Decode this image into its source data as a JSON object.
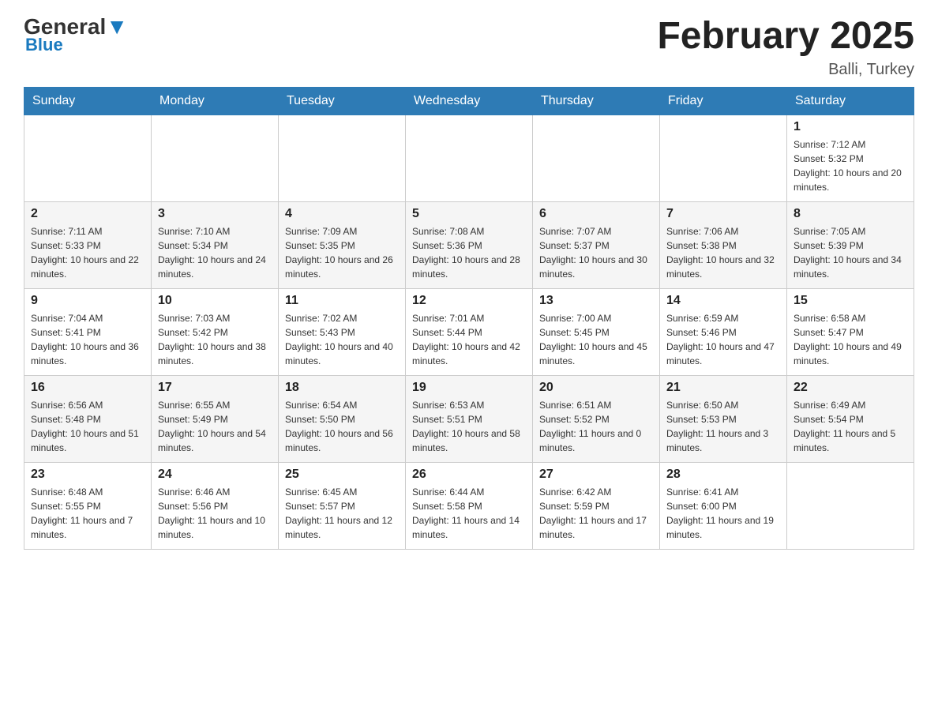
{
  "header": {
    "logo_general": "General",
    "logo_blue": "Blue",
    "month_title": "February 2025",
    "location": "Balli, Turkey"
  },
  "weekdays": [
    "Sunday",
    "Monday",
    "Tuesday",
    "Wednesday",
    "Thursday",
    "Friday",
    "Saturday"
  ],
  "rows": [
    [
      {
        "day": "",
        "info": ""
      },
      {
        "day": "",
        "info": ""
      },
      {
        "day": "",
        "info": ""
      },
      {
        "day": "",
        "info": ""
      },
      {
        "day": "",
        "info": ""
      },
      {
        "day": "",
        "info": ""
      },
      {
        "day": "1",
        "info": "Sunrise: 7:12 AM\nSunset: 5:32 PM\nDaylight: 10 hours and 20 minutes."
      }
    ],
    [
      {
        "day": "2",
        "info": "Sunrise: 7:11 AM\nSunset: 5:33 PM\nDaylight: 10 hours and 22 minutes."
      },
      {
        "day": "3",
        "info": "Sunrise: 7:10 AM\nSunset: 5:34 PM\nDaylight: 10 hours and 24 minutes."
      },
      {
        "day": "4",
        "info": "Sunrise: 7:09 AM\nSunset: 5:35 PM\nDaylight: 10 hours and 26 minutes."
      },
      {
        "day": "5",
        "info": "Sunrise: 7:08 AM\nSunset: 5:36 PM\nDaylight: 10 hours and 28 minutes."
      },
      {
        "day": "6",
        "info": "Sunrise: 7:07 AM\nSunset: 5:37 PM\nDaylight: 10 hours and 30 minutes."
      },
      {
        "day": "7",
        "info": "Sunrise: 7:06 AM\nSunset: 5:38 PM\nDaylight: 10 hours and 32 minutes."
      },
      {
        "day": "8",
        "info": "Sunrise: 7:05 AM\nSunset: 5:39 PM\nDaylight: 10 hours and 34 minutes."
      }
    ],
    [
      {
        "day": "9",
        "info": "Sunrise: 7:04 AM\nSunset: 5:41 PM\nDaylight: 10 hours and 36 minutes."
      },
      {
        "day": "10",
        "info": "Sunrise: 7:03 AM\nSunset: 5:42 PM\nDaylight: 10 hours and 38 minutes."
      },
      {
        "day": "11",
        "info": "Sunrise: 7:02 AM\nSunset: 5:43 PM\nDaylight: 10 hours and 40 minutes."
      },
      {
        "day": "12",
        "info": "Sunrise: 7:01 AM\nSunset: 5:44 PM\nDaylight: 10 hours and 42 minutes."
      },
      {
        "day": "13",
        "info": "Sunrise: 7:00 AM\nSunset: 5:45 PM\nDaylight: 10 hours and 45 minutes."
      },
      {
        "day": "14",
        "info": "Sunrise: 6:59 AM\nSunset: 5:46 PM\nDaylight: 10 hours and 47 minutes."
      },
      {
        "day": "15",
        "info": "Sunrise: 6:58 AM\nSunset: 5:47 PM\nDaylight: 10 hours and 49 minutes."
      }
    ],
    [
      {
        "day": "16",
        "info": "Sunrise: 6:56 AM\nSunset: 5:48 PM\nDaylight: 10 hours and 51 minutes."
      },
      {
        "day": "17",
        "info": "Sunrise: 6:55 AM\nSunset: 5:49 PM\nDaylight: 10 hours and 54 minutes."
      },
      {
        "day": "18",
        "info": "Sunrise: 6:54 AM\nSunset: 5:50 PM\nDaylight: 10 hours and 56 minutes."
      },
      {
        "day": "19",
        "info": "Sunrise: 6:53 AM\nSunset: 5:51 PM\nDaylight: 10 hours and 58 minutes."
      },
      {
        "day": "20",
        "info": "Sunrise: 6:51 AM\nSunset: 5:52 PM\nDaylight: 11 hours and 0 minutes."
      },
      {
        "day": "21",
        "info": "Sunrise: 6:50 AM\nSunset: 5:53 PM\nDaylight: 11 hours and 3 minutes."
      },
      {
        "day": "22",
        "info": "Sunrise: 6:49 AM\nSunset: 5:54 PM\nDaylight: 11 hours and 5 minutes."
      }
    ],
    [
      {
        "day": "23",
        "info": "Sunrise: 6:48 AM\nSunset: 5:55 PM\nDaylight: 11 hours and 7 minutes."
      },
      {
        "day": "24",
        "info": "Sunrise: 6:46 AM\nSunset: 5:56 PM\nDaylight: 11 hours and 10 minutes."
      },
      {
        "day": "25",
        "info": "Sunrise: 6:45 AM\nSunset: 5:57 PM\nDaylight: 11 hours and 12 minutes."
      },
      {
        "day": "26",
        "info": "Sunrise: 6:44 AM\nSunset: 5:58 PM\nDaylight: 11 hours and 14 minutes."
      },
      {
        "day": "27",
        "info": "Sunrise: 6:42 AM\nSunset: 5:59 PM\nDaylight: 11 hours and 17 minutes."
      },
      {
        "day": "28",
        "info": "Sunrise: 6:41 AM\nSunset: 6:00 PM\nDaylight: 11 hours and 19 minutes."
      },
      {
        "day": "",
        "info": ""
      }
    ]
  ]
}
